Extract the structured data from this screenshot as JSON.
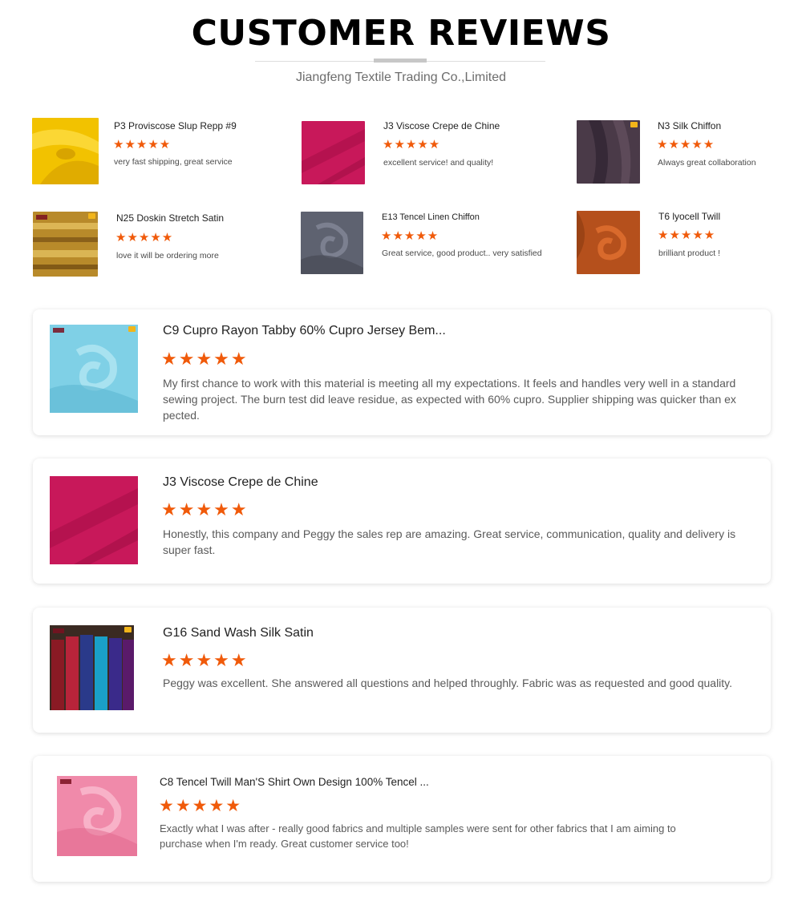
{
  "header": {
    "title": "CUSTOMER REVIEWS",
    "subtitle": "Jiangfeng Textile Trading Co.,Limited"
  },
  "rating_symbol": "★★★★★",
  "mini_reviews": [
    {
      "product": "P3 Proviscose Slup Repp #9",
      "rating": 5,
      "text": "very fast shipping, great service",
      "swatch_color": "#f2c200"
    },
    {
      "product": "J3 Viscose Crepe de Chine",
      "rating": 5,
      "text": "excellent service! and quality!",
      "swatch_color": "#c8185a"
    },
    {
      "product": "N3 Silk Chiffon",
      "rating": 5,
      "text": "Always great collaboration",
      "swatch_color": "#4a3a48"
    },
    {
      "product": "N25 Doskin Stretch Satin",
      "rating": 5,
      "text": "love it will be ordering more",
      "swatch_color": "#b88a2a"
    },
    {
      "product": "E13 Tencel Linen Chiffon",
      "rating": 5,
      "text": "Great service, good product.. very satisfied",
      "swatch_color": "#5e6270"
    },
    {
      "product": "T6 lyocell Twill",
      "rating": 5,
      "text": "brilliant product !",
      "swatch_color": "#b5501c"
    }
  ],
  "reviews": [
    {
      "product": "C9 Cupro Rayon Tabby 60% Cupro Jersey Bem...",
      "rating": 5,
      "text": "My first chance to work with this material is meeting all my expectations. It feels and handles very well in a standard sewing project. The burn test did leave residue, as expected with 60% cupro.  Supplier shipping was quicker than expected.",
      "swatch_color": "#7fd0e6"
    },
    {
      "product": "J3 Viscose Crepe de Chine",
      "rating": 5,
      "text": "Honestly, this company and Peggy the sales rep are amazing. Great service, communication, quality and delivery is super fast.",
      "swatch_color": "#c8185a"
    },
    {
      "product": "G16 Sand Wash Silk Satin",
      "rating": 5,
      "text": "Peggy was excellent. She answered all questions and helped throughly. Fabric was as requested and good quality.",
      "swatch_color": "#2a6fa8"
    },
    {
      "product": "C8 Tencel Twill Man'S Shirt Own Design 100% Tencel ...",
      "rating": 5,
      "text": "Exactly what I was after - really good fabrics and multiple samples were sent for other fabrics that I am aiming to purchase when I'm ready. Great customer service too!",
      "swatch_color": "#f08aaa"
    }
  ]
}
